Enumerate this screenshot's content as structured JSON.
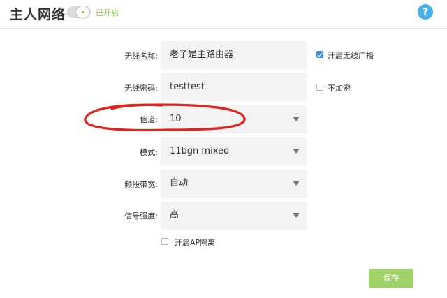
{
  "header": {
    "title": "主人网络",
    "toggle_state_label": "已开启",
    "help_glyph": "?"
  },
  "form": {
    "ssid": {
      "label": "无线名称:",
      "value": "老子是主路由器"
    },
    "password": {
      "label": "无线密码:",
      "value": "testtest"
    },
    "channel": {
      "label": "信道:",
      "value": "10"
    },
    "mode": {
      "label": "模式:",
      "value": "11bgn mixed"
    },
    "bandwidth": {
      "label": "频段带宽:",
      "value": "自动"
    },
    "signal": {
      "label": "信号强度:",
      "value": "高"
    },
    "broadcast": {
      "label": "开启无线广播",
      "checked": true
    },
    "no_encrypt": {
      "label": "不加密",
      "checked": false
    },
    "ap_isolation": {
      "label": "开启AP隔离",
      "checked": false
    }
  },
  "save_button": {
    "label": "保存"
  },
  "colors": {
    "accent_green": "#8cc63f",
    "save_green": "#9ed36a",
    "help_blue": "#4aaee8",
    "checkbox_blue": "#3e8ee0",
    "field_gray": "#f3f3f3",
    "annotation_red": "#e0231c"
  },
  "icons": {
    "help": "help-icon",
    "dropdown": "dropdown-arrow-icon",
    "checkbox": "checkbox-icon"
  }
}
